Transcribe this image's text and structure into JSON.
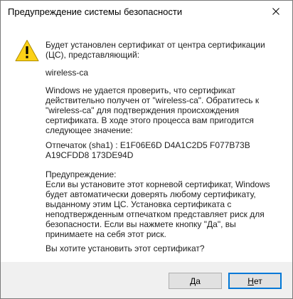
{
  "dialog": {
    "title": "Предупреждение системы безопасности",
    "intro": "Будет установлен сертификат от центра сертификации (ЦС), представляющий:",
    "ca_name": "wireless-ca",
    "body": "Windows не удается проверить, что сертификат действительно получен от \"wireless-ca\". Обратитесь к \"wireless-ca\" для подтверждения происхождения сертификата. В ходе этого процесса вам пригодится следующее значение:",
    "thumbprint_label": "Отпечаток (sha1) :",
    "thumbprint_value": "E1F06E6D D4A1C2D5 F077B73B A19CFDD8 173DE94D",
    "warning_heading": "Предупреждение:",
    "warning_text": "Если вы установите этот корневой сертификат, Windows будет автоматически доверять любому сертификату, выданному этим ЦС. Установка сертификата с неподтвержденным отпечатком представляет риск для безопасности. Если вы нажмете кнопку \"Да\", вы принимаете на себя этот риск.",
    "question": "Вы хотите установить этот сертификат?"
  },
  "buttons": {
    "yes_first": "Д",
    "yes_rest": "а",
    "no_first": "Н",
    "no_rest": "ет"
  },
  "icons": {
    "warning": "warning-triangle-icon",
    "close": "close-icon"
  },
  "colors": {
    "warning_fill": "#fcd116",
    "focus_border": "#0078d7",
    "footer_bg": "#f0f0f0"
  }
}
